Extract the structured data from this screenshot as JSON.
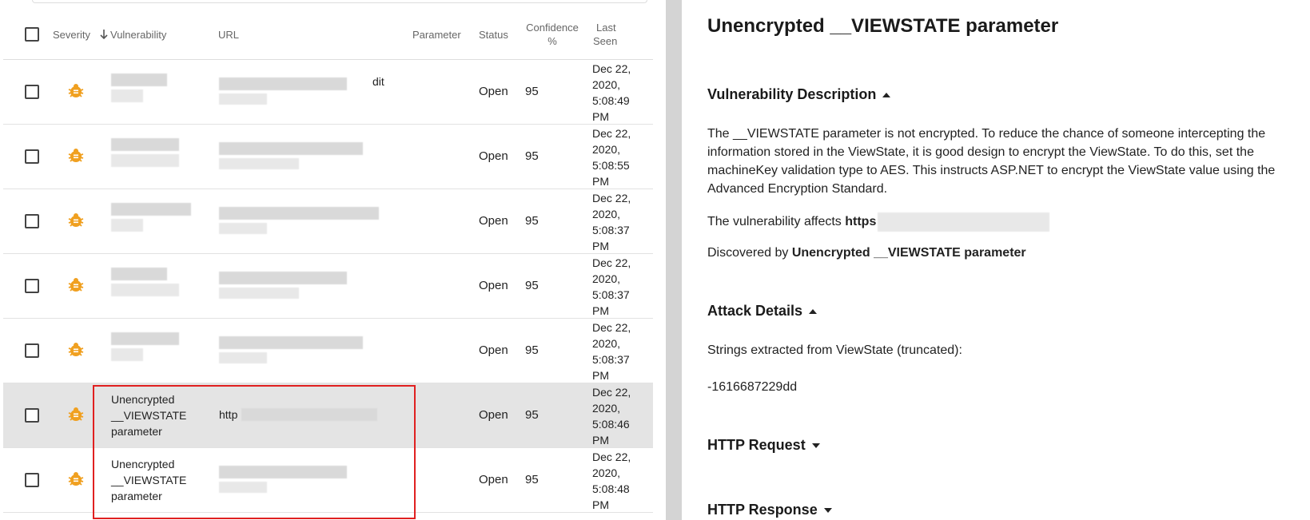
{
  "table": {
    "headers": {
      "severity": "Severity",
      "vulnerability": "Vulnerability",
      "url": "URL",
      "parameter": "Parameter",
      "status": "Status",
      "confidence_line1": "Confidence",
      "confidence_line2": "%",
      "last_seen_line1": "Last",
      "last_seen_line2": "Seen"
    },
    "rows": [
      {
        "vulnerability": "",
        "url_suffix": "dit",
        "status": "Open",
        "confidence": "95",
        "seen": [
          "Dec 22,",
          "2020,",
          "5:08:49",
          "PM"
        ]
      },
      {
        "vulnerability": "",
        "url_suffix": "",
        "status": "Open",
        "confidence": "95",
        "seen": [
          "Dec 22,",
          "2020,",
          "5:08:55",
          "PM"
        ]
      },
      {
        "vulnerability": "",
        "url_suffix": "",
        "status": "Open",
        "confidence": "95",
        "seen": [
          "Dec 22,",
          "2020,",
          "5:08:37",
          "PM"
        ]
      },
      {
        "vulnerability": "",
        "url_suffix": "",
        "status": "Open",
        "confidence": "95",
        "seen": [
          "Dec 22,",
          "2020,",
          "5:08:37",
          "PM"
        ]
      },
      {
        "vulnerability": "",
        "url_suffix": "",
        "status": "Open",
        "confidence": "95",
        "seen": [
          "Dec 22,",
          "2020,",
          "5:08:37",
          "PM"
        ]
      },
      {
        "vulnerability": [
          "Unencrypted",
          "__VIEWSTATE",
          "parameter"
        ],
        "url_prefix": "http",
        "status": "Open",
        "confidence": "95",
        "seen": [
          "Dec 22,",
          "2020,",
          "5:08:46",
          "PM"
        ]
      },
      {
        "vulnerability": [
          "Unencrypted",
          "__VIEWSTATE",
          "parameter"
        ],
        "url_prefix": "",
        "status": "Open",
        "confidence": "95",
        "seen": [
          "Dec 22,",
          "2020,",
          "5:08:48",
          "PM"
        ]
      }
    ],
    "severity_color": "#f0a020",
    "highlight_color": "#e02020"
  },
  "detail": {
    "title": "Unencrypted __VIEWSTATE parameter",
    "sections": {
      "description": "Vulnerability Description",
      "attack": "Attack Details",
      "request": "HTTP Request",
      "response": "HTTP Response"
    },
    "description_text": "The __VIEWSTATE parameter is not encrypted. To reduce the chance of someone intercepting the information stored in the ViewState, it is good design to encrypt the ViewState. To do this, set the machineKey validation type to AES. This instructs ASP.NET to encrypt the ViewState value using the Advanced Encryption Standard.",
    "affects_prefix": "The vulnerability affects ",
    "affects_value": "https",
    "discovered_prefix": "Discovered by ",
    "discovered_value": "Unencrypted __VIEWSTATE parameter",
    "attack_text": "Strings extracted from ViewState (truncated):",
    "attack_value": "-1616687229dd"
  }
}
